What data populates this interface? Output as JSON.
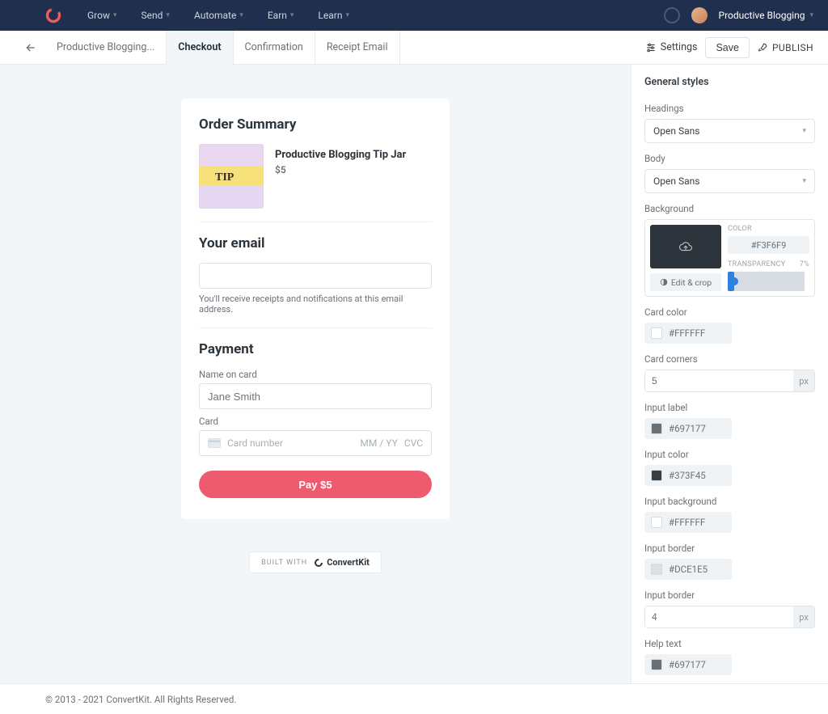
{
  "nav": {
    "items": [
      "Grow",
      "Send",
      "Automate",
      "Earn",
      "Learn"
    ],
    "account": "Productive Blogging"
  },
  "subnav": {
    "crumb": "Productive Blogging...",
    "tabs": [
      "Checkout",
      "Confirmation",
      "Receipt Email"
    ],
    "active": 0,
    "settings": "Settings",
    "save": "Save",
    "publish": "PUBLISH"
  },
  "order": {
    "summary_title": "Order Summary",
    "product_title": "Productive Blogging Tip Jar",
    "product_price": "$5"
  },
  "email": {
    "title": "Your email",
    "help": "You'll receive receipts and notifications at this email address."
  },
  "payment": {
    "title": "Payment",
    "name_label": "Name on card",
    "name_placeholder": "Jane Smith",
    "card_label": "Card",
    "card_number_placeholder": "Card number",
    "card_exp_placeholder": "MM / YY",
    "card_cvc_placeholder": "CVC",
    "pay_button": "Pay $5"
  },
  "builtwith": {
    "prefix": "BUILT WITH",
    "brand": "ConvertKit"
  },
  "panel": {
    "title": "General styles",
    "headings_label": "Headings",
    "headings_value": "Open Sans",
    "body_label": "Body",
    "body_value": "Open Sans",
    "background_label": "Background",
    "bg_color_label": "COLOR",
    "bg_color_value": "#F3F6F9",
    "bg_transparency_label": "TRANSPARENCY",
    "bg_transparency_value": "7%",
    "edit_crop": "Edit & crop",
    "card_color_label": "Card color",
    "card_color_value": "#FFFFFF",
    "card_corners_label": "Card corners",
    "card_corners_value": "5",
    "card_corners_unit": "px",
    "input_label_label": "Input label",
    "input_label_value": "#697177",
    "input_color_label": "Input color",
    "input_color_value": "#373F45",
    "input_bg_label": "Input background",
    "input_bg_value": "#FFFFFF",
    "input_border_label": "Input border",
    "input_border_value": "#DCE1E5",
    "input_border_radius_label": "Input border",
    "input_border_radius_value": "4",
    "input_border_radius_unit": "px",
    "help_text_label": "Help text",
    "help_text_value": "#697177"
  },
  "footer": "© 2013 - 2021 ConvertKit. All Rights Reserved."
}
